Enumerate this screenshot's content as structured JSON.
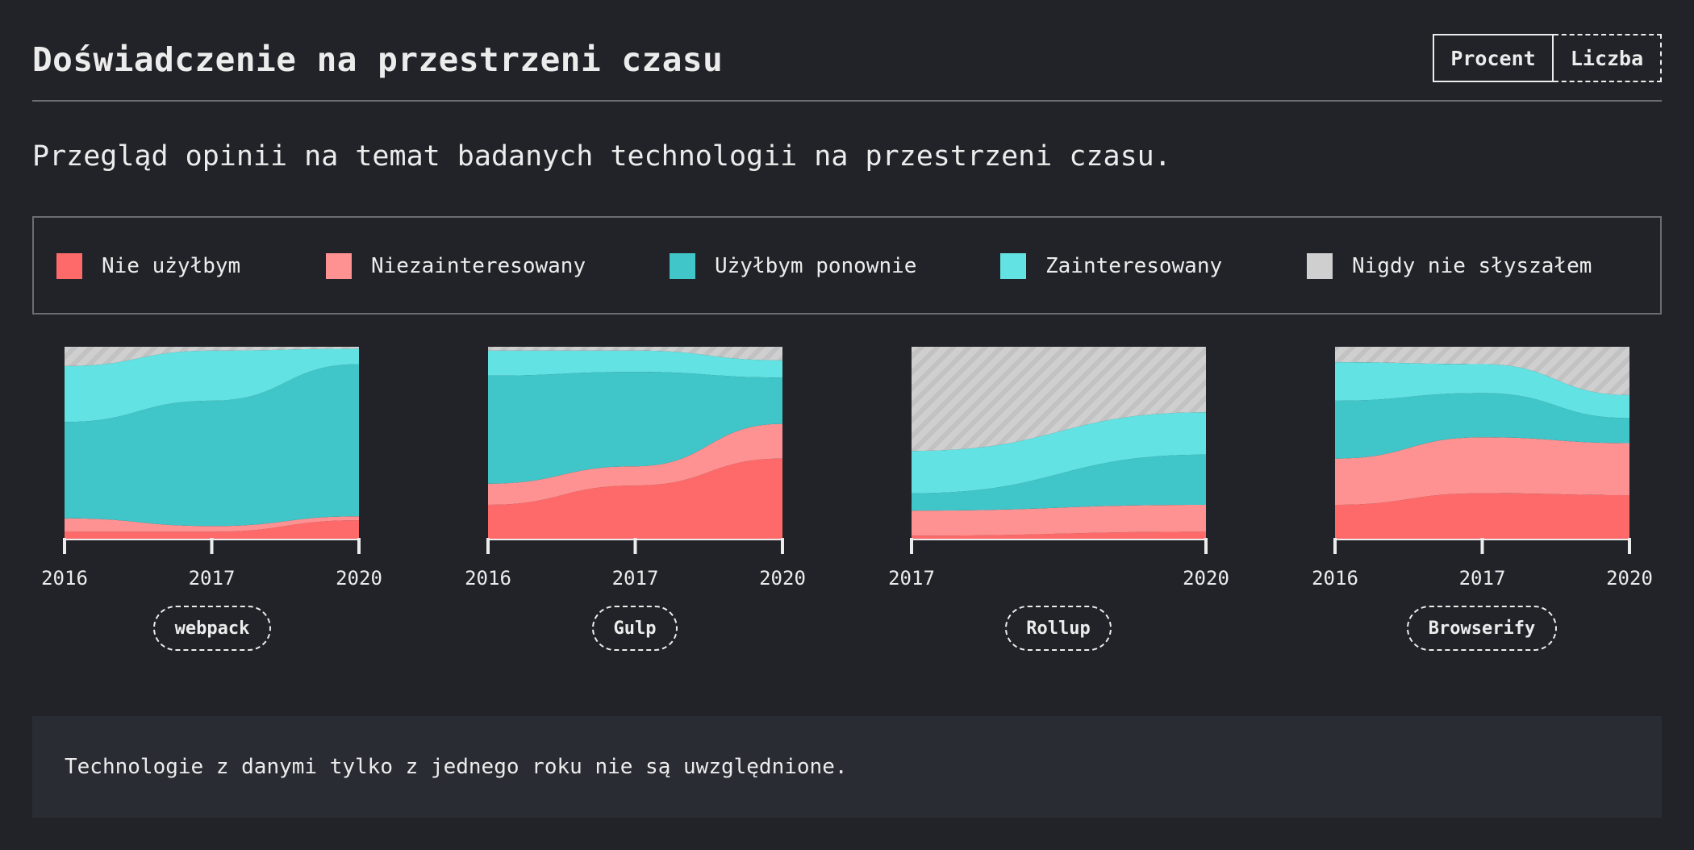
{
  "header": {
    "title": "Doświadczenie na przestrzeni czasu"
  },
  "toggle": {
    "percent_label": "Procent",
    "count_label": "Liczba",
    "active": "percent"
  },
  "subtitle": "Przegląd opinii na temat badanych technologii na przestrzeni czasu.",
  "legend": {
    "items": [
      {
        "key": "would_not_use",
        "label": "Nie użyłbym",
        "color": "#fe6a6a"
      },
      {
        "key": "not_interested",
        "label": "Niezainteresowany",
        "color": "#fe9191"
      },
      {
        "key": "would_use",
        "label": "Użyłbym ponownie",
        "color": "#40c5c8"
      },
      {
        "key": "interested",
        "label": "Zainteresowany",
        "color": "#62e2e2"
      },
      {
        "key": "never_heard",
        "label": "Nigdy nie słyszałem",
        "color": "#cfcfcf"
      }
    ]
  },
  "footnote": "Technologie z danymi tylko z jednego roku nie są uwzględnione.",
  "chart_data": [
    {
      "type": "area",
      "stacked": true,
      "normalized": true,
      "technology": "webpack",
      "x": [
        "2016",
        "2017",
        "2020"
      ],
      "ylim": [
        0,
        100
      ],
      "series": [
        {
          "key": "would_not_use",
          "values": [
            4,
            4,
            10
          ]
        },
        {
          "key": "not_interested",
          "values": [
            7,
            3,
            2
          ]
        },
        {
          "key": "would_use",
          "values": [
            50,
            65,
            79
          ]
        },
        {
          "key": "interested",
          "values": [
            29,
            26,
            8
          ]
        },
        {
          "key": "never_heard",
          "values": [
            10,
            2,
            1
          ]
        }
      ]
    },
    {
      "type": "area",
      "stacked": true,
      "normalized": true,
      "technology": "Gulp",
      "x": [
        "2016",
        "2017",
        "2020"
      ],
      "ylim": [
        0,
        100
      ],
      "series": [
        {
          "key": "would_not_use",
          "values": [
            18,
            28,
            42
          ]
        },
        {
          "key": "not_interested",
          "values": [
            11,
            10,
            18
          ]
        },
        {
          "key": "would_use",
          "values": [
            56,
            49,
            24
          ]
        },
        {
          "key": "interested",
          "values": [
            13,
            11,
            9
          ]
        },
        {
          "key": "never_heard",
          "values": [
            2,
            2,
            7
          ]
        }
      ]
    },
    {
      "type": "area",
      "stacked": true,
      "normalized": true,
      "technology": "Rollup",
      "x": [
        "2017",
        "2020"
      ],
      "ylim": [
        0,
        100
      ],
      "series": [
        {
          "key": "would_not_use",
          "values": [
            2,
            4
          ]
        },
        {
          "key": "not_interested",
          "values": [
            13,
            14
          ]
        },
        {
          "key": "would_use",
          "values": [
            9,
            26
          ]
        },
        {
          "key": "interested",
          "values": [
            22,
            22
          ]
        },
        {
          "key": "never_heard",
          "values": [
            54,
            34
          ]
        }
      ]
    },
    {
      "type": "area",
      "stacked": true,
      "normalized": true,
      "technology": "Browserify",
      "x": [
        "2016",
        "2017",
        "2020"
      ],
      "ylim": [
        0,
        100
      ],
      "series": [
        {
          "key": "would_not_use",
          "values": [
            18,
            24,
            23
          ]
        },
        {
          "key": "not_interested",
          "values": [
            24,
            29,
            27
          ]
        },
        {
          "key": "would_use",
          "values": [
            30,
            23,
            13
          ]
        },
        {
          "key": "interested",
          "values": [
            20,
            15,
            12
          ]
        },
        {
          "key": "never_heard",
          "values": [
            8,
            9,
            25
          ]
        }
      ]
    }
  ]
}
